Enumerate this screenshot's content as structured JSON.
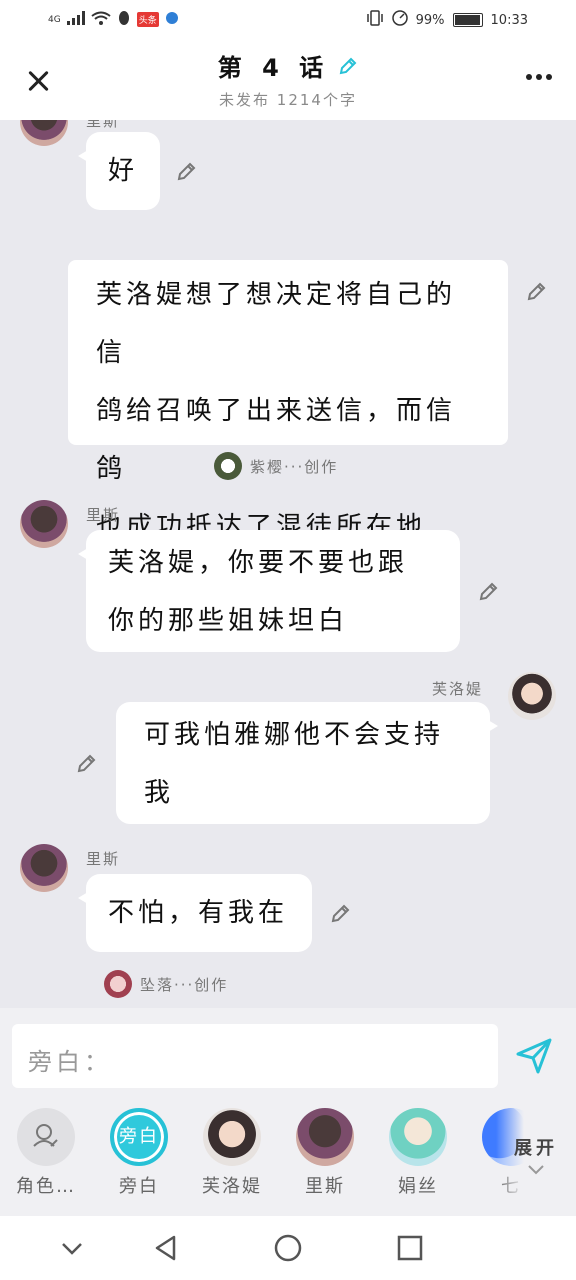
{
  "status_bar": {
    "network": "4G",
    "app_badge": "头条",
    "battery": "99%",
    "time": "10:33"
  },
  "header": {
    "title": "第 4 话",
    "subtitle": "未发布 1214个字"
  },
  "messages": [
    {
      "type": "character",
      "side": "left",
      "name": "里斯",
      "text": "好"
    },
    {
      "type": "narration",
      "text_lines": [
        "芙洛媞想了想决定将自己的信",
        "鸽给召唤了出来送信，而信鸽",
        "也成功抵达了混徒所在地"
      ],
      "creator": "紫樱···创作"
    },
    {
      "type": "character",
      "side": "left",
      "name": "里斯",
      "text_lines": [
        "芙洛媞，你要不要也跟",
        "你的那些姐妹坦白"
      ]
    },
    {
      "type": "character",
      "side": "right",
      "name": "芙洛媞",
      "text_lines": [
        "可我怕雅娜他不会支持",
        "我"
      ]
    },
    {
      "type": "character",
      "side": "left",
      "name": "里斯",
      "text": "不怕，有我在",
      "creator": "坠落···创作"
    }
  ],
  "input": {
    "placeholder": "旁白："
  },
  "characters": [
    {
      "label": "角色…",
      "icon": "role-icon"
    },
    {
      "label": "旁白",
      "icon_text": "旁白"
    },
    {
      "label": "芙洛媞"
    },
    {
      "label": "里斯"
    },
    {
      "label": "娟丝"
    },
    {
      "label": "七"
    }
  ],
  "expand_label": "展开",
  "colors": {
    "accent": "#27c1d6",
    "background": "#e9e9ee"
  }
}
